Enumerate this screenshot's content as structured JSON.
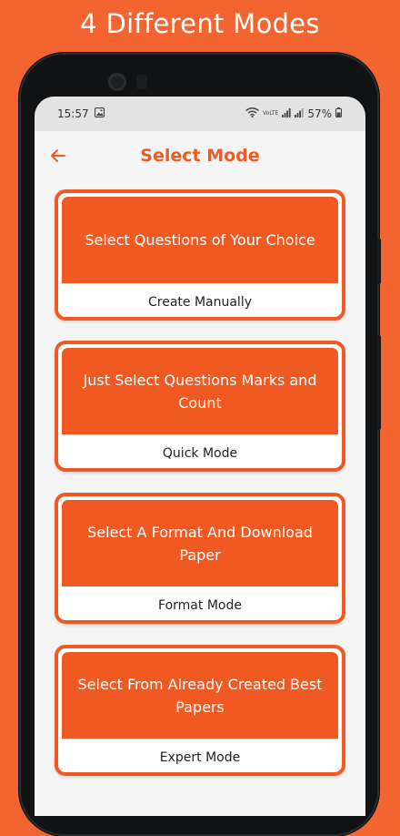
{
  "promo": {
    "title": "4 Different Modes"
  },
  "status_bar": {
    "time": "15:57",
    "volte_label": "VoLTE",
    "battery": "57%"
  },
  "app_bar": {
    "title": "Select Mode"
  },
  "modes": [
    {
      "description": "Select Questions of Your Choice",
      "label": "Create Manually"
    },
    {
      "description": "Just Select Questions Marks and Count",
      "label": "Quick Mode"
    },
    {
      "description": "Select A Format And Download Paper",
      "label": "Format Mode"
    },
    {
      "description": "Select From Already Created Best Papers",
      "label": "Expert Mode"
    }
  ],
  "colors": {
    "background": "#F26530",
    "accent": "#F05A22",
    "screen": "#F5F5F5",
    "status_bar": "#E3E3E3"
  }
}
